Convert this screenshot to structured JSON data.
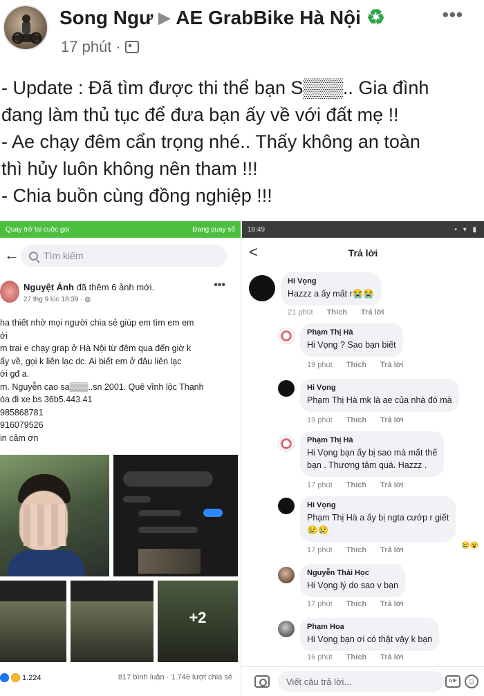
{
  "post": {
    "author": "Song Ngư",
    "arrow": "▶",
    "group": "AE GrabBike Hà Nội",
    "recycle_glyph": "♻",
    "time": "17 phút",
    "dot": "·",
    "more": "•••",
    "lines": [
      "- Update : Đã tìm được thi thể bạn S▒▒▒.. Gia đình",
      "đang làm thủ tục để đưa bạn ấy về với đất mẹ !!",
      "- Ae chạy đêm cẩn trọng nhé.. Thấy không an toàn",
      "thì hủy luôn không nên tham !!!",
      "- Chia buồn cùng đồng nghiệp !!!"
    ]
  },
  "left": {
    "call_bar_left": "Quay trở lại cuộc gọi",
    "call_bar_right": "Đang quay số",
    "back": "←",
    "search_placeholder": "Tìm kiếm",
    "name": "Nguyệt Ánh",
    "name_suffix": " đã thêm 6 ảnh mới.",
    "date": "27 thg 9 lúc 18:39 · ",
    "more": "•••",
    "lines": [
      "ha thiết nhờ mọi người chia sẻ giúp em tìm em em",
      "ới",
      "m trai e chạy grap ở Hà Nội từ đêm qua đến giờ k",
      "ấy về, gọi k liên lạc dc.  Ai biết em ở đâu liên lạc",
      "ới gđ a.",
      "m. Nguyễn cao sa▒▒▒..sn 2001. Quê vĩnh lộc Thanh",
      "óa đi xe bs 36b5.443.41",
      "985868781",
      "916079526",
      "in cảm ơn"
    ],
    "plus_more": "+2",
    "reaction_count": "1.224",
    "stats": "817 bình luận · 1.746 lượt chia sẻ"
  },
  "right": {
    "status_time": "18:49",
    "status_icons": "▪ ▾ ▮",
    "back": "<",
    "title": "Trả lời",
    "comments": [
      {
        "name": "Hi Vọng",
        "text": "Hazzz a ấy mất r😭😭",
        "time": "21 phút",
        "like": "Thích",
        "reply": "Trả lời"
      },
      {
        "name": "Phạm Thị Hà",
        "text": "Hi Vọng ? Sao bạn biết",
        "time": "19 phút",
        "like": "Thích",
        "reply": "Trả lời"
      },
      {
        "name": "Hi Vọng",
        "text": "Phạm Thị Hà mk là ae của nhà đó mà",
        "time": "19 phút",
        "like": "Thích",
        "reply": "Trả lời"
      },
      {
        "name": "Phạm Thị Hà",
        "text1": "Hi Vọng  bạn ấy bị sao mà mất thế",
        "text2": "bạn . Thương tâm quá. Hazzz .",
        "time": "17 phút",
        "like": "Thích",
        "reply": "Trả lời"
      },
      {
        "name": "Hi Vọng",
        "text1": "Phạm Thị Hà a ấy bị ngta cướp r giết",
        "text2": "😢😢",
        "time": "17 phút",
        "like": "Thích",
        "reply": "Trả lời",
        "reaction": "😢😮"
      },
      {
        "name": "Nguyễn Thái Học",
        "text": "Hi Vọng lý do sao v bạn",
        "time": "17 phút",
        "like": "Thích",
        "reply": "Trả lời"
      },
      {
        "name": "Phạm Hoa",
        "text": "Hi Vọng  bạn ơi có thật vậy k bạn",
        "time": "16 phút",
        "like": "Thích",
        "reply": "Trả lời"
      }
    ],
    "input_placeholder": "Viết câu trả lời...",
    "gif": "GIF",
    "emoji": "☺"
  }
}
